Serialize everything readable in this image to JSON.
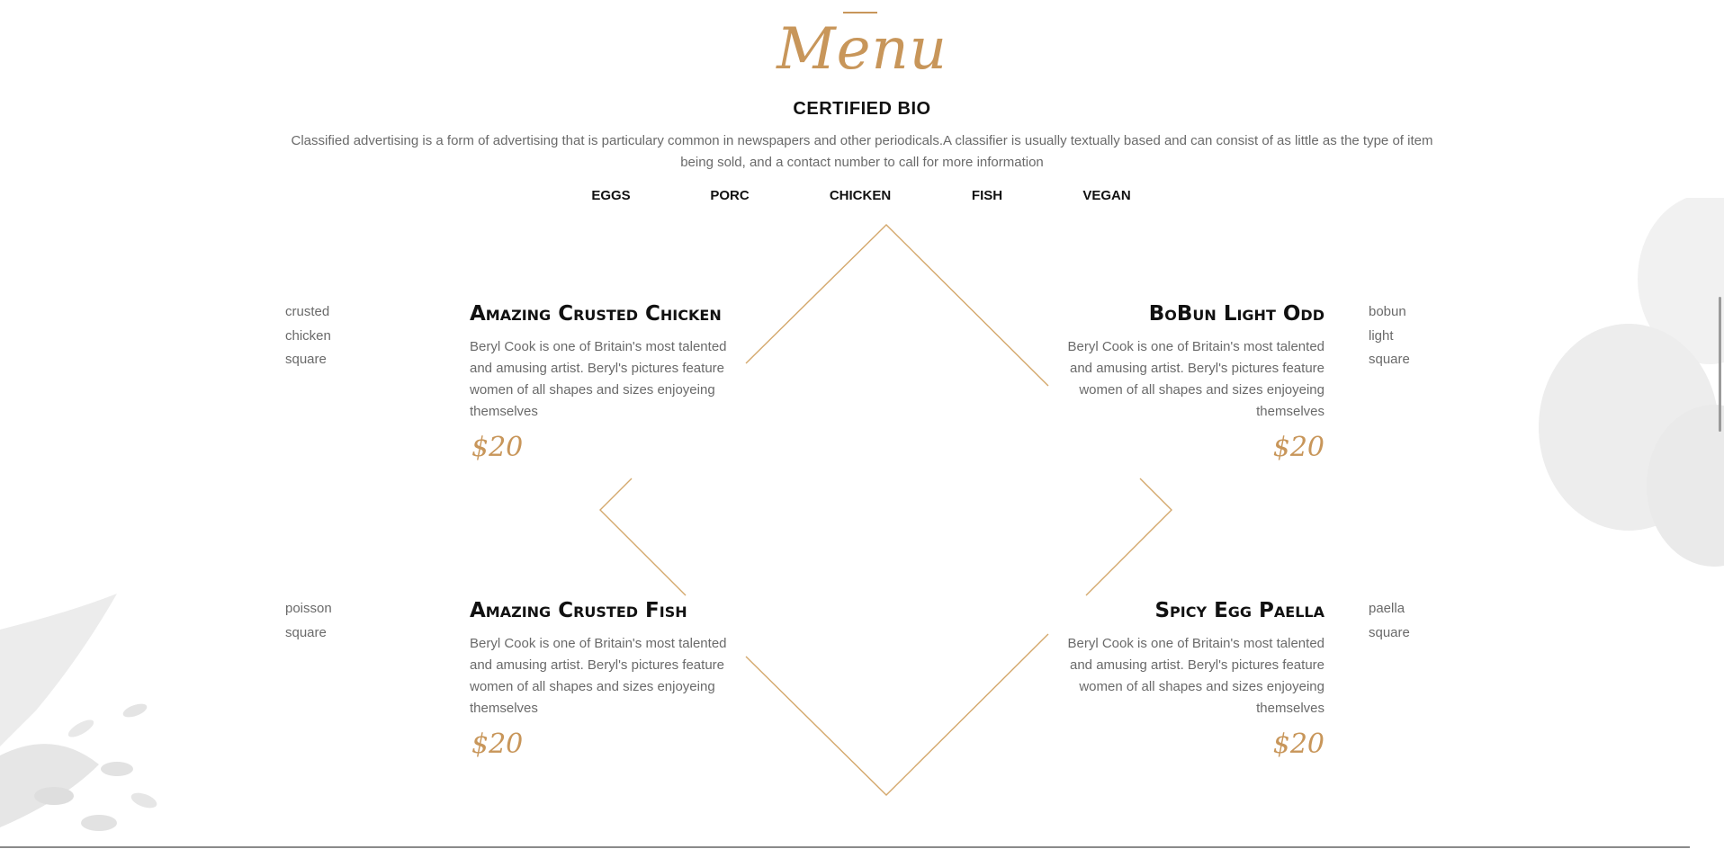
{
  "header": {
    "title": "Menu",
    "subtitle": "CERTIFIED BIO",
    "intro": "Classified advertising is a form of advertising that is particulary common in newspapers and other periodicals.A classifier is usually textually based and can consist of as little as the type of item being sold, and a contact number to call for more information"
  },
  "tabs": [
    "EGGS",
    "PORC",
    "CHICKEN",
    "FISH",
    "VEGAN"
  ],
  "items": [
    {
      "title": "Amazing Crusted Chicken",
      "description": "Beryl Cook is one of Britain's most talented and amusing artist. Beryl's pictures feature women of all shapes and sizes enjoyeing themselves",
      "price": "$20",
      "tags": [
        "crusted",
        "chicken",
        "square"
      ]
    },
    {
      "title": "BoBun Light Odd",
      "description": "Beryl Cook is one of Britain's most talented and amusing artist. Beryl's pictures feature women of all shapes and sizes enjoyeing themselves",
      "price": "$20",
      "tags": [
        "bobun",
        "light",
        "square"
      ]
    },
    {
      "title": "Amazing Crusted Fish",
      "description": "Beryl Cook is one of Britain's most talented and amusing artist. Beryl's pictures feature women of all shapes and sizes enjoyeing themselves",
      "price": "$20",
      "tags": [
        "poisson",
        "square"
      ]
    },
    {
      "title": "Spicy Egg Paella",
      "description": "Beryl Cook is one of Britain's most talented and amusing artist. Beryl's pictures feature women of all shapes and sizes enjoyeing themselves",
      "price": "$20",
      "tags": [
        "paella",
        "square"
      ]
    }
  ],
  "colors": {
    "accent": "#c8965a",
    "text": "#111111",
    "muted": "#6a6a6a"
  },
  "icons": {
    "background_left": "leaf-and-grain-image",
    "background_right": "eggs-image"
  }
}
